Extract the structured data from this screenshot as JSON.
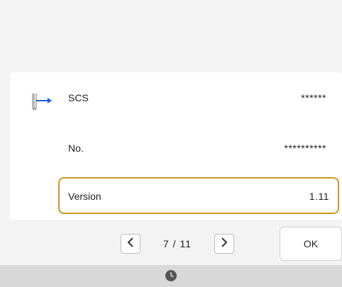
{
  "info_panel": {
    "rows": [
      {
        "label": "SCS",
        "value": "******"
      },
      {
        "label": "No.",
        "value": "**********"
      },
      {
        "label": "Version",
        "value": "1.11"
      }
    ],
    "icon": "needle-thread-icon",
    "highlight_color": "#c99a1e"
  },
  "pagination": {
    "current_page": "7",
    "separator": "/",
    "total_pages": "11",
    "prev_icon": "chevron-left-icon",
    "next_icon": "chevron-right-icon"
  },
  "ok_button": {
    "label": "OK"
  },
  "status_bar": {
    "icon": "clock-icon"
  }
}
